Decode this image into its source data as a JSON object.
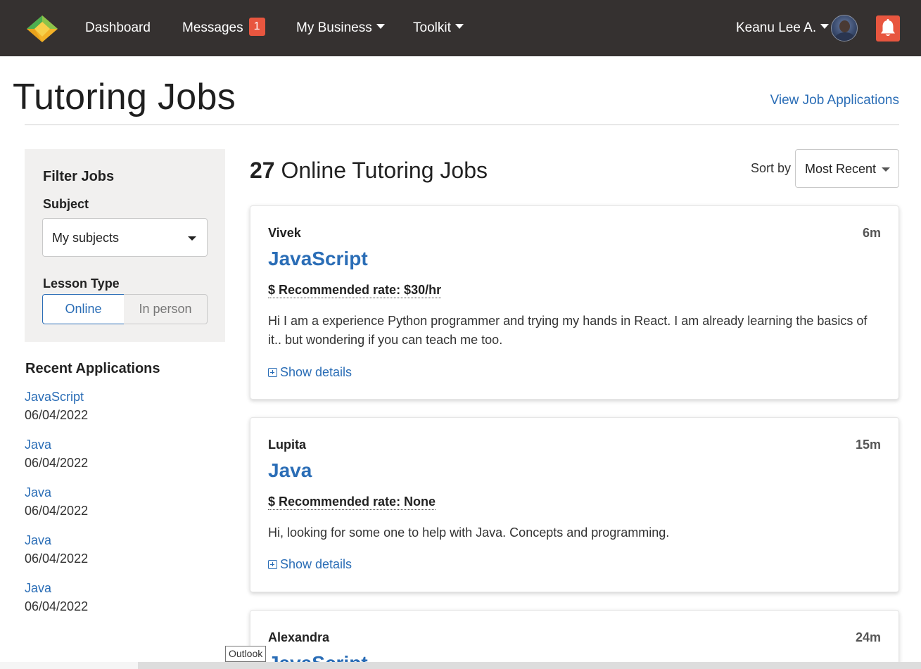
{
  "nav": {
    "dashboard": "Dashboard",
    "messages": "Messages",
    "messages_count": "1",
    "my_business": "My Business",
    "toolkit": "Toolkit",
    "user_name": "Keanu Lee A.",
    "accent_color": "#e8563f",
    "bg_color": "#353130"
  },
  "page": {
    "title": "Tutoring Jobs",
    "view_applications": "View Job Applications"
  },
  "filter": {
    "heading": "Filter Jobs",
    "subject_label": "Subject",
    "subject_value": "My subjects",
    "lesson_type_label": "Lesson Type",
    "lesson_online": "Online",
    "lesson_in_person": "In person",
    "selected": "Online"
  },
  "recent": {
    "heading": "Recent Applications",
    "items": [
      {
        "subject": "JavaScript",
        "date": "06/04/2022"
      },
      {
        "subject": "Java",
        "date": "06/04/2022"
      },
      {
        "subject": "Java",
        "date": "06/04/2022"
      },
      {
        "subject": "Java",
        "date": "06/04/2022"
      },
      {
        "subject": "Java",
        "date": "06/04/2022"
      }
    ]
  },
  "jobs": {
    "count": "27",
    "count_label": "Online Tutoring Jobs",
    "sort_label": "Sort by",
    "sort_value": "Most Recent",
    "show_details": "Show details",
    "list": [
      {
        "student": "Vivek",
        "time": "6m",
        "subject": "JavaScript",
        "rate": "$ Recommended rate: $30/hr",
        "description": "Hi I am a experience Python programmer and trying my hands in React. I am already learning the basics of it.. but wondering if you can teach me too."
      },
      {
        "student": "Lupita",
        "time": "15m",
        "subject": "Java",
        "rate": "$ Recommended rate: None",
        "description": "Hi, looking for some one to help with Java. Concepts and programming."
      },
      {
        "student": "Alexandra",
        "time": "24m",
        "subject": "JavaScript"
      }
    ]
  },
  "tooltip": "Outlook",
  "link_color": "#2a6db6"
}
